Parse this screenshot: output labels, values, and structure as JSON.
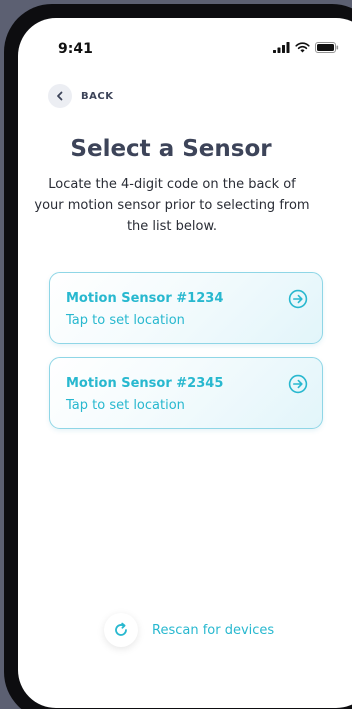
{
  "status_bar": {
    "time": "9:41"
  },
  "nav": {
    "back_label": "BACK"
  },
  "header": {
    "title": "Select a Sensor",
    "subtitle": "Locate the 4-digit code on the back of your motion sensor prior to selecting from the list below."
  },
  "devices": [
    {
      "name": "Motion Sensor #1234",
      "action": "Tap to set location"
    },
    {
      "name": "Motion Sensor #2345",
      "action": "Tap to set location"
    }
  ],
  "footer": {
    "rescan_label": "Rescan for devices"
  },
  "colors": {
    "accent": "#28b8cf",
    "title": "#3d4459",
    "card_border": "#8fd6e6"
  }
}
